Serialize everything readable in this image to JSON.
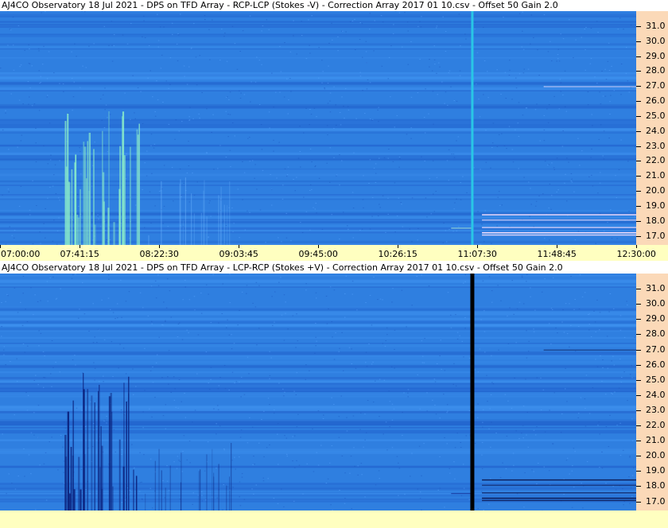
{
  "panels": [
    {
      "title": "AJ4CO Observatory 18 Jul 2021  -  DPS on TFD Array  -  RCP-LCP (Stokes -V)  -  Correction Array 2017 01 10.csv  -  Offset 50  Gain 2.0"
    },
    {
      "title": "AJ4CO Observatory 18 Jul 2021  -  DPS on TFD Array  -  LCP-RCP (Stokes +V)  -  Correction Array 2017 01 10.csv  -  Offset 50  Gain 2.0"
    }
  ],
  "colors": {
    "background_blue": "#2f7fe0",
    "stripe_light": "#3f92ef",
    "stripe_dark": "#1f5ec9",
    "burst_bright": "#8ef0c8",
    "burst_dark": "#0a1f7a",
    "axis_y_bg": "#fbd9b8",
    "axis_x_bg": "#ffffc0",
    "top_marker": "#29c6e6",
    "bottom_marker": "#000000"
  },
  "chart_data": [
    {
      "type": "heatmap",
      "title": "AJ4CO Observatory 18 Jul 2021  -  DPS on TFD Array  -  RCP-LCP (Stokes -V)  -  Correction Array 2017 01 10.csv  -  Offset 50  Gain 2.0",
      "x_ticks": [
        "07:00:00",
        "07:41:15",
        "08:22:30",
        "09:03:45",
        "09:45:00",
        "10:26:15",
        "11:07:30",
        "11:48:45",
        "12:30:00"
      ],
      "y_ticks": [
        "31.0",
        "30.0",
        "29.0",
        "28.0",
        "27.0",
        "26.0",
        "25.0",
        "24.0",
        "23.0",
        "22.0",
        "21.0",
        "20.0",
        "19.0",
        "18.0",
        "17.0"
      ],
      "ylim": [
        16.4,
        32.0
      ],
      "marker_time": "11:05:00",
      "marker_color": "#29c6e6"
    },
    {
      "type": "heatmap",
      "title": "AJ4CO Observatory 18 Jul 2021  -  DPS on TFD Array  -  LCP-RCP (Stokes +V)  -  Correction Array 2017 01 10.csv  -  Offset 50  Gain 2.0",
      "x_ticks": [],
      "y_ticks": [
        "31.0",
        "30.0",
        "29.0",
        "28.0",
        "27.0",
        "26.0",
        "25.0",
        "24.0",
        "23.0",
        "22.0",
        "21.0",
        "20.0",
        "19.0",
        "18.0",
        "17.0"
      ],
      "ylim": [
        16.4,
        32.0
      ],
      "marker_time": "11:05:00",
      "marker_color": "#000000"
    }
  ]
}
